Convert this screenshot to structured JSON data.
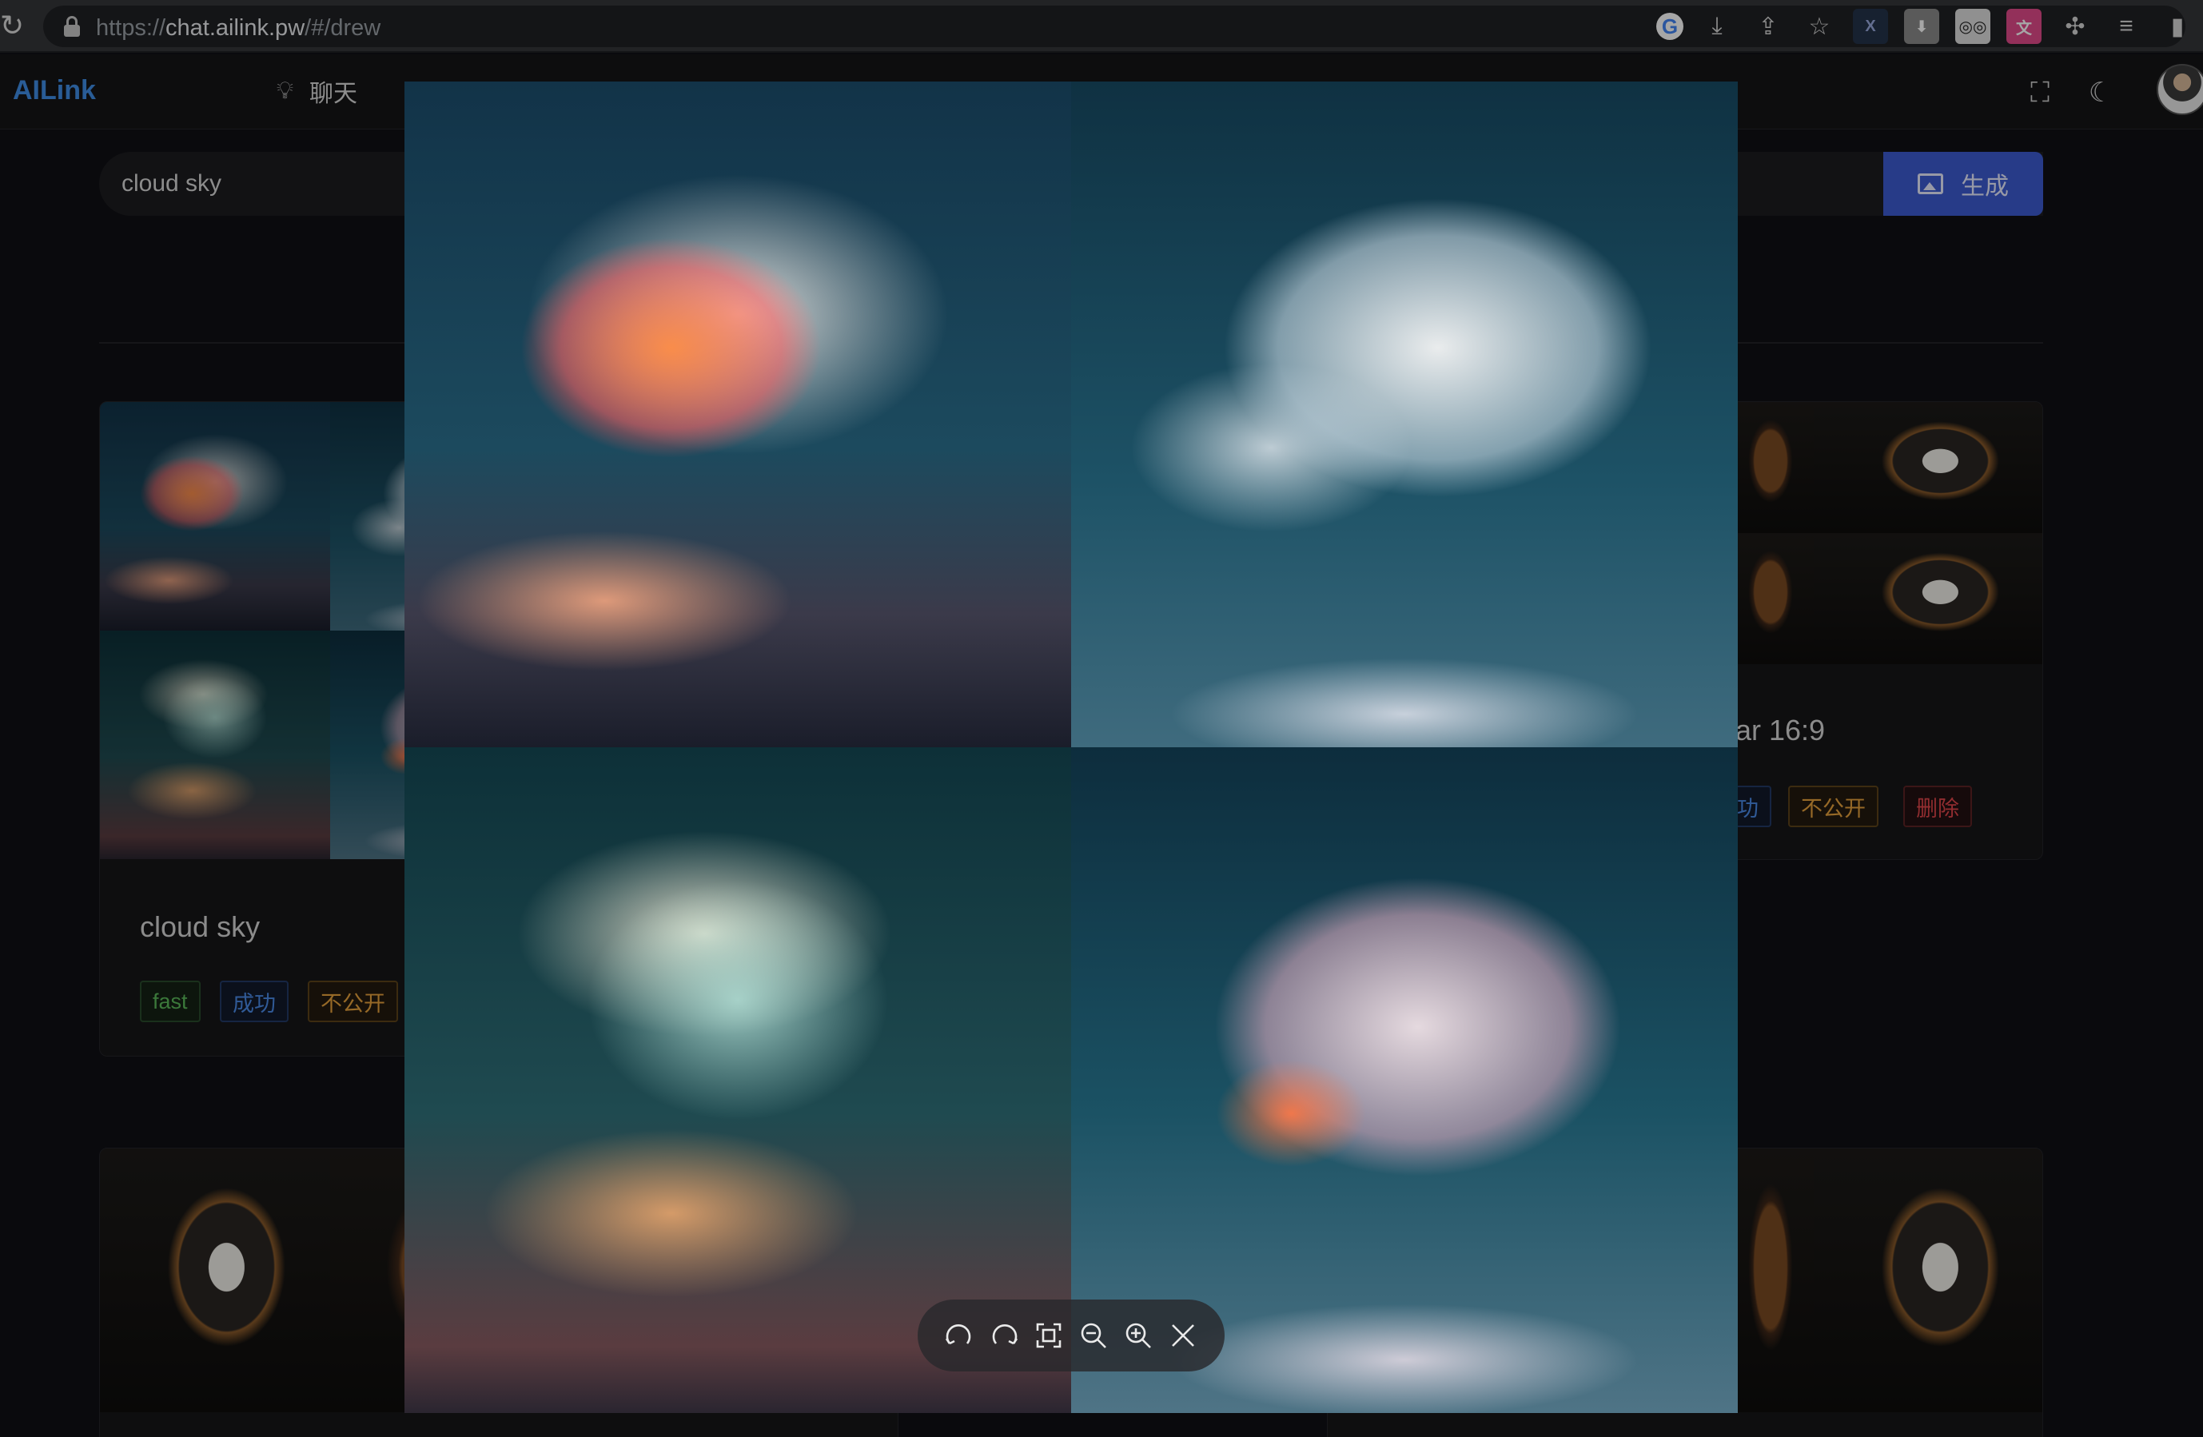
{
  "browser": {
    "url_prefix": "https://",
    "url_domain": "chat.ailink.pw",
    "url_path": "/#/drew",
    "icons": [
      "reload-icon",
      "lock-icon",
      "google-icon",
      "install-icon",
      "share-icon",
      "star-icon",
      "extension-x-icon",
      "download-icon",
      "reader-icon",
      "translate-icon",
      "puzzle-icon",
      "media-icon",
      "sidebar-icon"
    ]
  },
  "header": {
    "logo": "AILink",
    "nav": [
      {
        "label": "聊天",
        "icon": "bulb-icon"
      }
    ],
    "right_icons": [
      "fullscreen-icon",
      "moon-icon",
      "avatar"
    ]
  },
  "search": {
    "value": "cloud sky",
    "placeholder": "",
    "button_label": "生成"
  },
  "cards": [
    {
      "title": "cloud sky",
      "tags": [
        "fast",
        "成功",
        "不公开"
      ]
    },
    {
      "title": "ar 16:9",
      "tags": [
        "功",
        "不公开",
        "删除"
      ]
    }
  ],
  "viewer": {
    "toolbar": [
      "rotate-left-icon",
      "rotate-right-icon",
      "fit-icon",
      "zoom-out-icon",
      "zoom-in-icon",
      "close-icon"
    ]
  },
  "colors": {
    "accent": "#3d5bd1",
    "logo": "#3f8ee6",
    "tag_green": "#5bb85a",
    "tag_blue": "#4a8be8",
    "tag_orange": "#e7a23d",
    "tag_red": "#e0454a"
  }
}
